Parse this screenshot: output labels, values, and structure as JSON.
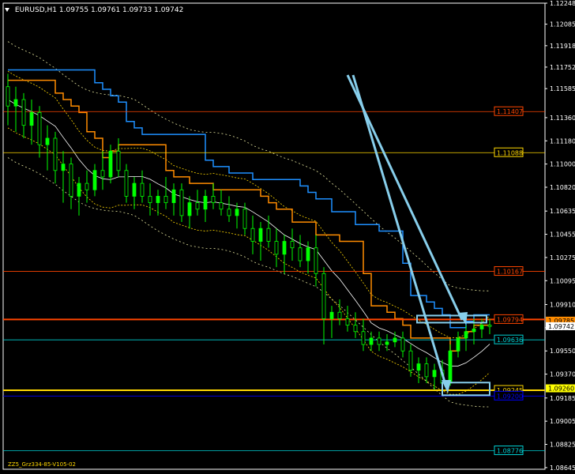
{
  "window": {
    "symbol": "EURUSD,H1",
    "ohlc": "1.09755 1.09761 1.09733 1.09742",
    "footer": "ZZ5_Grz334-85-V105-02"
  },
  "colors": {
    "background": "#000000",
    "axis": "#ffffff",
    "candle_bull": "#00ff00",
    "candle_bear": "#00ff00",
    "blue_stairs": "#1e90ff",
    "orange_stairs": "#ff8c00",
    "cyan_arrows": "#87ceeb",
    "yellow_line": "#ffd700",
    "red_line": "#ff4500"
  },
  "chart_data": {
    "type": "candlestick",
    "ylim": [
      1.08632,
      1.12248
    ],
    "y_ticks": [
      "1.12248",
      "1.12085",
      "1.11918",
      "1.11752",
      "1.11585",
      "1.11360",
      "1.11180",
      "1.11000",
      "1.10820",
      "1.10635",
      "1.10455",
      "1.10275",
      "1.10095",
      "1.09910",
      "1.09730",
      "1.09550",
      "1.09370",
      "1.09185",
      "1.09005",
      "1.08825",
      "1.08645"
    ],
    "horizontal_levels": [
      {
        "value": 1.11407,
        "label": "1.11407",
        "color": "#ff4500",
        "style": "solid",
        "box": "#ff4500"
      },
      {
        "value": 1.11088,
        "label": "1.11088",
        "color": "#ffd700",
        "style": "solid",
        "box": "#ffd700"
      },
      {
        "value": 1.10167,
        "label": "1.10167",
        "color": "#ff4500",
        "style": "solid",
        "box": "#ff4500"
      },
      {
        "value": 1.09794,
        "label": "1.09794",
        "color": "#ff4500",
        "style": "thick",
        "box": "#ff4500"
      },
      {
        "value": 1.09636,
        "label": "1.09636",
        "color": "#00ced1",
        "style": "solid",
        "box": "#00ced1"
      },
      {
        "value": 1.09245,
        "label": "1.09245",
        "color": "#ffd700",
        "style": "thick",
        "box": "#ffd700"
      },
      {
        "value": 1.092,
        "label": "1.09200",
        "color": "#0000ff",
        "style": "solid",
        "box": "#0000ff"
      },
      {
        "value": 1.08776,
        "label": "1.08776",
        "color": "#00ced1",
        "style": "solid",
        "box": "#00ced1"
      }
    ],
    "axis_tags": [
      {
        "value": 1.09785,
        "label": "1.09785",
        "bg": "#ff8c00",
        "fg": "#000000"
      },
      {
        "value": 1.09742,
        "label": "1.09742",
        "bg": "#ffffff",
        "fg": "#000000"
      },
      {
        "value": 1.0926,
        "label": "1.09260",
        "bg": "#ffff00",
        "fg": "#000000"
      }
    ],
    "candles": [
      {
        "o": 1.116,
        "h": 1.117,
        "l": 1.113,
        "c": 1.1145
      },
      {
        "o": 1.1145,
        "h": 1.116,
        "l": 1.1125,
        "c": 1.115
      },
      {
        "o": 1.115,
        "h": 1.1155,
        "l": 1.112,
        "c": 1.113
      },
      {
        "o": 1.113,
        "h": 1.115,
        "l": 1.1115,
        "c": 1.114
      },
      {
        "o": 1.114,
        "h": 1.1145,
        "l": 1.1105,
        "c": 1.1115
      },
      {
        "o": 1.1115,
        "h": 1.113,
        "l": 1.1095,
        "c": 1.112
      },
      {
        "o": 1.112,
        "h": 1.1125,
        "l": 1.1085,
        "c": 1.1095
      },
      {
        "o": 1.1095,
        "h": 1.111,
        "l": 1.107,
        "c": 1.11
      },
      {
        "o": 1.11,
        "h": 1.1105,
        "l": 1.1065,
        "c": 1.1075
      },
      {
        "o": 1.1075,
        "h": 1.109,
        "l": 1.106,
        "c": 1.1085
      },
      {
        "o": 1.1085,
        "h": 1.1095,
        "l": 1.107,
        "c": 1.108
      },
      {
        "o": 1.108,
        "h": 1.11,
        "l": 1.1075,
        "c": 1.1095
      },
      {
        "o": 1.1095,
        "h": 1.111,
        "l": 1.108,
        "c": 1.109
      },
      {
        "o": 1.109,
        "h": 1.1115,
        "l": 1.1085,
        "c": 1.111
      },
      {
        "o": 1.111,
        "h": 1.112,
        "l": 1.109,
        "c": 1.1095
      },
      {
        "o": 1.1095,
        "h": 1.11,
        "l": 1.107,
        "c": 1.1075
      },
      {
        "o": 1.1075,
        "h": 1.109,
        "l": 1.1065,
        "c": 1.1085
      },
      {
        "o": 1.1085,
        "h": 1.1095,
        "l": 1.107,
        "c": 1.1075
      },
      {
        "o": 1.1075,
        "h": 1.1085,
        "l": 1.106,
        "c": 1.107
      },
      {
        "o": 1.107,
        "h": 1.108,
        "l": 1.106,
        "c": 1.1075
      },
      {
        "o": 1.1075,
        "h": 1.109,
        "l": 1.1065,
        "c": 1.107
      },
      {
        "o": 1.107,
        "h": 1.1085,
        "l": 1.106,
        "c": 1.108
      },
      {
        "o": 1.108,
        "h": 1.1085,
        "l": 1.1055,
        "c": 1.106
      },
      {
        "o": 1.106,
        "h": 1.1075,
        "l": 1.105,
        "c": 1.107
      },
      {
        "o": 1.107,
        "h": 1.108,
        "l": 1.106,
        "c": 1.1065
      },
      {
        "o": 1.1065,
        "h": 1.108,
        "l": 1.1055,
        "c": 1.1075
      },
      {
        "o": 1.1075,
        "h": 1.1085,
        "l": 1.1065,
        "c": 1.107
      },
      {
        "o": 1.107,
        "h": 1.108,
        "l": 1.106,
        "c": 1.1065
      },
      {
        "o": 1.1065,
        "h": 1.1075,
        "l": 1.1055,
        "c": 1.106
      },
      {
        "o": 1.106,
        "h": 1.107,
        "l": 1.105,
        "c": 1.1065
      },
      {
        "o": 1.1065,
        "h": 1.107,
        "l": 1.1045,
        "c": 1.105
      },
      {
        "o": 1.105,
        "h": 1.106,
        "l": 1.103,
        "c": 1.104
      },
      {
        "o": 1.104,
        "h": 1.1055,
        "l": 1.1025,
        "c": 1.105
      },
      {
        "o": 1.105,
        "h": 1.106,
        "l": 1.1035,
        "c": 1.104
      },
      {
        "o": 1.104,
        "h": 1.105,
        "l": 1.102,
        "c": 1.103
      },
      {
        "o": 1.103,
        "h": 1.1045,
        "l": 1.1015,
        "c": 1.104
      },
      {
        "o": 1.104,
        "h": 1.105,
        "l": 1.1025,
        "c": 1.1035
      },
      {
        "o": 1.1035,
        "h": 1.1045,
        "l": 1.102,
        "c": 1.1025
      },
      {
        "o": 1.1025,
        "h": 1.104,
        "l": 1.1015,
        "c": 1.1035
      },
      {
        "o": 1.1035,
        "h": 1.1045,
        "l": 1.1005,
        "c": 1.1015
      },
      {
        "o": 1.1015,
        "h": 1.102,
        "l": 1.096,
        "c": 1.098
      },
      {
        "o": 1.098,
        "h": 1.099,
        "l": 1.0965,
        "c": 1.0985
      },
      {
        "o": 1.0985,
        "h": 1.0995,
        "l": 1.0975,
        "c": 1.098
      },
      {
        "o": 1.098,
        "h": 1.099,
        "l": 1.097,
        "c": 1.0975
      },
      {
        "o": 1.0975,
        "h": 1.0985,
        "l": 1.0965,
        "c": 1.097
      },
      {
        "o": 1.097,
        "h": 1.098,
        "l": 1.0955,
        "c": 1.096
      },
      {
        "o": 1.096,
        "h": 1.097,
        "l": 1.0955,
        "c": 1.0965
      },
      {
        "o": 1.0965,
        "h": 1.097,
        "l": 1.0955,
        "c": 1.096
      },
      {
        "o": 1.096,
        "h": 1.0968,
        "l": 1.0955,
        "c": 1.0962
      },
      {
        "o": 1.0962,
        "h": 1.097,
        "l": 1.0958,
        "c": 1.0965
      },
      {
        "o": 1.0965,
        "h": 1.097,
        "l": 1.095,
        "c": 1.0955
      },
      {
        "o": 1.0955,
        "h": 1.096,
        "l": 1.0935,
        "c": 1.094
      },
      {
        "o": 1.094,
        "h": 1.095,
        "l": 1.093,
        "c": 1.0945
      },
      {
        "o": 1.0945,
        "h": 1.095,
        "l": 1.093,
        "c": 1.0935
      },
      {
        "o": 1.0935,
        "h": 1.0945,
        "l": 1.0925,
        "c": 1.094
      },
      {
        "o": 1.094,
        "h": 1.0948,
        "l": 1.0925,
        "c": 1.093
      },
      {
        "o": 1.093,
        "h": 1.096,
        "l": 1.0928,
        "c": 1.0955
      },
      {
        "o": 1.0955,
        "h": 1.097,
        "l": 1.095,
        "c": 1.0965
      },
      {
        "o": 1.0965,
        "h": 1.0975,
        "l": 1.0955,
        "c": 1.097
      },
      {
        "o": 1.097,
        "h": 1.098,
        "l": 1.096,
        "c": 1.0972
      },
      {
        "o": 1.0972,
        "h": 1.098,
        "l": 1.0965,
        "c": 1.0975
      },
      {
        "o": 1.0975,
        "h": 1.098,
        "l": 1.0968,
        "c": 1.0974
      }
    ]
  }
}
